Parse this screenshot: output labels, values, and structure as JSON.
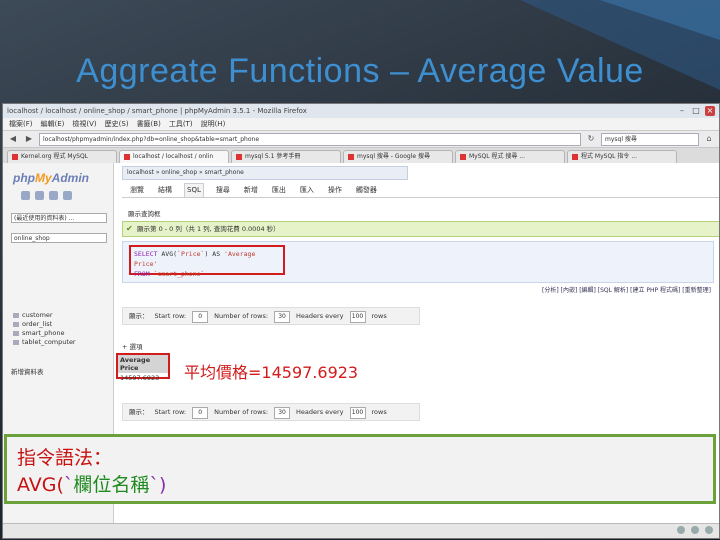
{
  "slide": {
    "title": "Aggreate Functions – Average Value"
  },
  "window": {
    "title": "localhost / localhost / online_shop / smart_phone | phpMyAdmin 3.5.1 - Mozilla Firefox",
    "menu": [
      "檔案(F)",
      "編輯(E)",
      "檢視(V)",
      "歷史(S)",
      "書籤(B)",
      "工具(T)",
      "說明(H)"
    ],
    "url": "localhost/phpmyadmin/index.php?db=online_shop&table=smart_phone",
    "search": "mysql 搜尋",
    "tabs": [
      "Kernel.org 程式 MySQL",
      "localhost / localhost / onlin",
      "mysql 5.1 參考手冊",
      "mysql 搜尋 - Google 搜尋",
      "MySQL 程式 搜尋 ...",
      "程式 MySQL 指令 ..."
    ]
  },
  "sidebar": {
    "logo_php": "php",
    "logo_my": "My",
    "logo_admin": "Admin",
    "select1": "(最近使用的資料表) ...",
    "select2": "online_shop",
    "tables": [
      "customer",
      "order_list",
      "smart_phone",
      "tablet_computer"
    ],
    "create": "新增資料表"
  },
  "main": {
    "breadcrumb": "localhost » online_shop » smart_phone",
    "toptabs": [
      "瀏覽",
      "結構",
      "SQL",
      "搜尋",
      "新增",
      "匯出",
      "匯入",
      "操作",
      "觸發器"
    ],
    "label1": "顯示查詢框",
    "success": "顯示第 0 - 0 列（共 1 列, 查詢花費 0.0004 秒）",
    "sql_line1_kw": "SELECT",
    "sql_line1_fn": " AVG(",
    "sql_line1_col": "`Price`",
    "sql_line1_as": ") AS ",
    "sql_line1_alias": "'Average Price'",
    "sql_line2_kw": "FROM",
    "sql_line2_tbl": " `smart_phone`",
    "links": "[分析] [內嵌] [編輯] [SQL 解析] [建立 PHP 程式碼] [重新整理]",
    "ctrl_show": "顯示：",
    "ctrl_start": "Start row:",
    "ctrl_start_val": "0",
    "ctrl_rows": "Number of rows:",
    "ctrl_rows_val": "30",
    "ctrl_headers": "Headers every",
    "ctrl_headers_val": "100",
    "ctrl_rows_suffix": "rows",
    "result_label": "+ 選項",
    "result_header": "Average Price",
    "result_value": "14597.6923",
    "note": "平均價格=14597.6923"
  },
  "callout": {
    "line1": "指令語法：",
    "fn": "AVG(",
    "tick_open": "`",
    "field": "欄位名稱",
    "tick_close": "`",
    "close": ")"
  }
}
